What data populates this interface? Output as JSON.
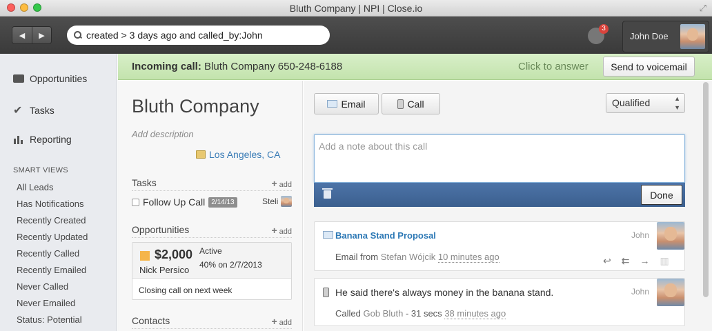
{
  "window": {
    "title": "Bluth Company | NPI | Close.io"
  },
  "topbar": {
    "search_value": "created > 3 days ago and called_by:John",
    "notification_count": "3",
    "user_name": "John Doe"
  },
  "sidebar": {
    "nav": [
      {
        "label": "Opportunities",
        "icon": "briefcase-icon"
      },
      {
        "label": "Tasks",
        "icon": "checkmark-icon"
      },
      {
        "label": "Reporting",
        "icon": "bar-chart-icon"
      }
    ],
    "smart_views_header": "SMART VIEWS",
    "smart_views": [
      "All Leads",
      "Has Notifications",
      "Recently Created",
      "Recently Updated",
      "Recently Called",
      "Recently Emailed",
      "Never Called",
      "Never Emailed",
      "Status: Potential"
    ]
  },
  "callbar": {
    "incoming_label": "Incoming call:",
    "caller": "Bluth Company 650-248-6188",
    "click_to_answer": "Click to answer",
    "voicemail_button": "Send to voicemail"
  },
  "lead": {
    "name": "Bluth Company",
    "description_placeholder": "Add description",
    "location": "Los Angeles, CA",
    "tasks_title": "Tasks",
    "add_label": "add",
    "task": {
      "label": "Follow Up Call",
      "date": "2/14/13",
      "assignee": "Steli"
    },
    "opportunities_title": "Opportunities",
    "opportunity": {
      "value": "$2,000",
      "status": "Active",
      "confidence": "40% on 2/7/2013",
      "contact": "Nick Persico",
      "note": "Closing call on next week"
    },
    "contacts_title": "Contacts"
  },
  "actions": {
    "email_button": "Email",
    "call_button": "Call",
    "status_value": "Qualified",
    "note_placeholder": "Add a note about this call",
    "done_button": "Done"
  },
  "activities": [
    {
      "title": "Banana Stand Proposal",
      "author": "John",
      "meta_prefix": "Email from",
      "meta_name": "Stefan Wójcik",
      "time": "10 minutes ago"
    },
    {
      "title": "He said there's always money in the banana stand.",
      "author": "John",
      "meta_prefix": "Called",
      "meta_name": "Gob Bluth",
      "duration": "- 31 secs",
      "time": "38 minutes ago"
    }
  ],
  "colors": {
    "accent_blue": "#3b5f8e",
    "call_green": "#c3e3ad",
    "link": "#2c78b5",
    "badge_red": "#d9433c"
  }
}
